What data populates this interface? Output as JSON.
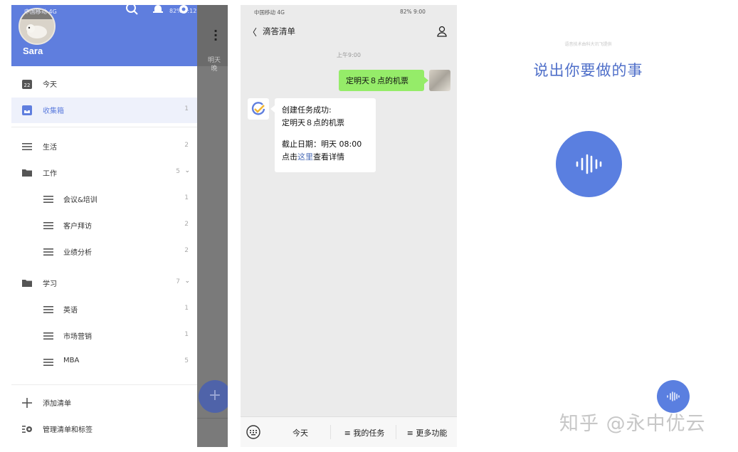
{
  "drawer": {
    "status_left": "中国移动 4G",
    "status_right": "82% 9:12",
    "username": "Sara",
    "behind": {
      "date_text": "明天 晚",
      "fab": "+"
    },
    "items": [
      {
        "label": "今天",
        "count": "",
        "icon": "calendar-icon",
        "badge": "22"
      },
      {
        "label": "收集箱",
        "count": "1",
        "icon": "inbox-icon"
      },
      {
        "label": "生活",
        "count": "2",
        "icon": "list-icon"
      },
      {
        "label": "工作",
        "count": "5",
        "icon": "folder-icon"
      },
      {
        "label": "会议&培训",
        "count": "1",
        "icon": "list-icon"
      },
      {
        "label": "客户拜访",
        "count": "2",
        "icon": "list-icon"
      },
      {
        "label": "业绩分析",
        "count": "2",
        "icon": "list-icon"
      },
      {
        "label": "学习",
        "count": "7",
        "icon": "folder-icon"
      },
      {
        "label": "英语",
        "count": "1",
        "icon": "list-icon"
      },
      {
        "label": "市场营销",
        "count": "1",
        "icon": "list-icon"
      },
      {
        "label": "MBA",
        "count": "5",
        "icon": "list-icon"
      },
      {
        "label": "添加清单",
        "count": "",
        "icon": "plus-icon"
      },
      {
        "label": "管理清单和标签",
        "count": "",
        "icon": "settings-icon"
      }
    ]
  },
  "chat": {
    "status_left": "中国移动 4G",
    "status_right": "82% 9:00",
    "title": "滴答清单",
    "time": "上午9:00",
    "my_message": "定明天８点的机票",
    "bot_line1": "创建任务成功:",
    "bot_line2": "定明天８点的机票",
    "bot_line3": "截止日期：明天 08:00",
    "bot_line4_pre": "点击",
    "bot_link": "这里",
    "bot_line4_post": "查看详情",
    "tabs": [
      "今天",
      "≡ 我的任务",
      "≡ 更多功能"
    ]
  },
  "voice": {
    "credit": "语音技术由科大讯飞提供",
    "prompt": "说出你要做的事",
    "watermark": "知乎 @永中优云"
  },
  "colors": {
    "accent": "#5f7ede",
    "chat_green": "#95ec69",
    "mic_blue": "#5a7fe0"
  }
}
